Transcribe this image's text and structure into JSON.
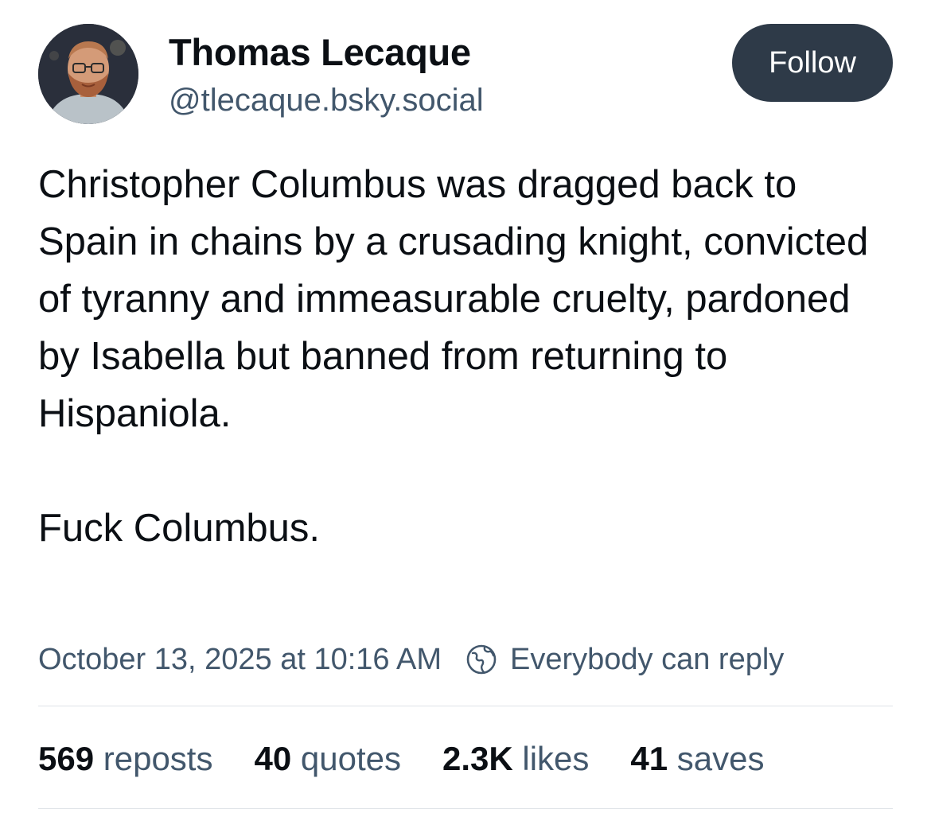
{
  "author": {
    "name": "Thomas Lecaque",
    "handle": "@tlecaque.bsky.social",
    "avatar_icon": "profile-photo"
  },
  "follow_label": "Follow",
  "post": {
    "paragraphs": [
      "Christopher Columbus was dragged back to Spain in chains by a crusading knight, convicted of tyranny and immeasurable cruelty, pardoned by Isabella but banned from returning to Hispaniola.",
      "Fuck Columbus."
    ],
    "timestamp": "October 13, 2025 at 10:16 AM",
    "reply_setting": "Everybody can reply",
    "reply_icon": "earth-icon"
  },
  "stats": {
    "reposts": {
      "count": "569",
      "label": "reposts"
    },
    "quotes": {
      "count": "40",
      "label": "quotes"
    },
    "likes": {
      "count": "2.3K",
      "label": "likes"
    },
    "saves": {
      "count": "41",
      "label": "saves"
    }
  },
  "colors": {
    "text_primary": "#0b0f14",
    "text_secondary": "#42576c",
    "follow_button_bg": "#2e3a48",
    "divider": "#dfe3e8"
  }
}
